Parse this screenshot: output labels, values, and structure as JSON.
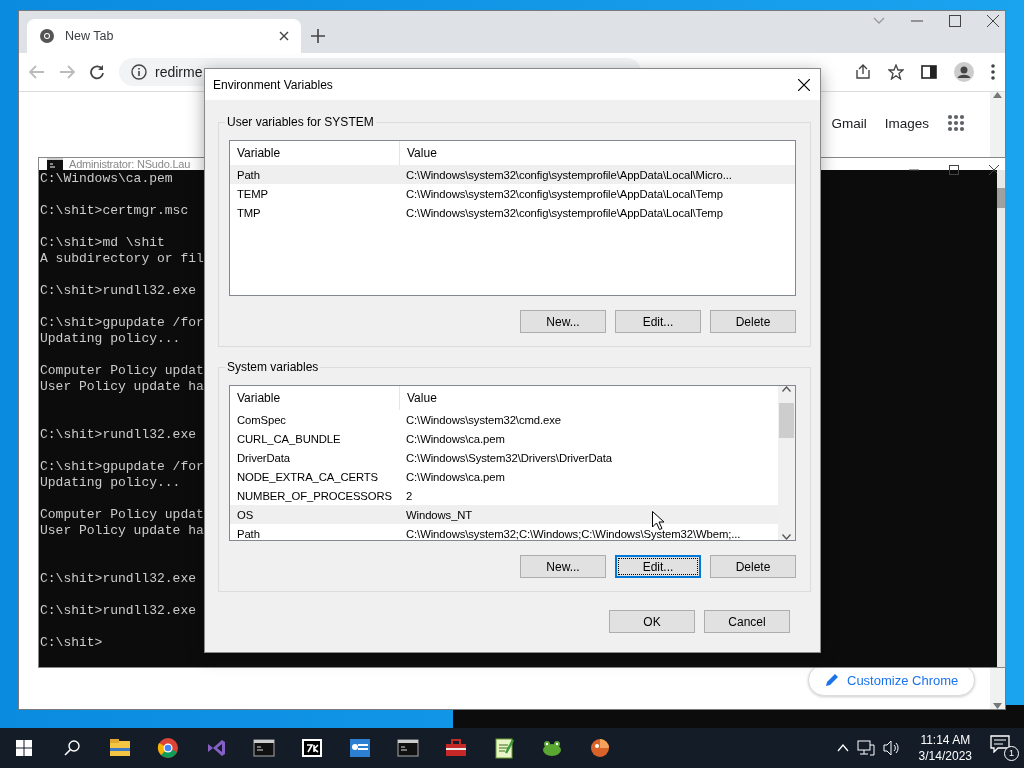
{
  "browser": {
    "tab": {
      "title": "New Tab"
    },
    "address": "redirme",
    "links": [
      "Gmail",
      "Images"
    ],
    "customize_button": "Customize Chrome"
  },
  "console": {
    "title": "Administrator: NSudo.Lau",
    "groups": [
      {
        "lines": [
          "C:\\Windows\\ca.pem"
        ],
        "extra_blank": false
      },
      {
        "lines": [
          "C:\\shit>certmgr.msc"
        ],
        "extra_blank": false
      },
      {
        "lines": [
          "C:\\shit>md \\shit",
          "A subdirectory or fil"
        ],
        "extra_blank": false
      },
      {
        "lines": [
          "C:\\shit>rundll32.exe"
        ],
        "extra_blank": false
      },
      {
        "lines": [
          "C:\\shit>gpupdate /for",
          "Updating policy..."
        ],
        "extra_blank": false
      },
      {
        "lines": [
          "Computer Policy updat",
          "User Policy update ha"
        ],
        "extra_blank": true
      },
      {
        "lines": [
          "C:\\shit>rundll32.exe"
        ],
        "extra_blank": false
      },
      {
        "lines": [
          "C:\\shit>gpupdate /for",
          "Updating policy..."
        ],
        "extra_blank": false
      },
      {
        "lines": [
          "Computer Policy updat",
          "User Policy update ha"
        ],
        "extra_blank": true
      },
      {
        "lines": [
          "C:\\shit>rundll32.exe"
        ],
        "extra_blank": false
      },
      {
        "lines": [
          "C:\\shit>rundll32.exe"
        ],
        "extra_blank": false
      },
      {
        "lines": [
          "C:\\shit>"
        ],
        "extra_blank": false
      }
    ]
  },
  "dialog": {
    "title": "Environment Variables",
    "sections": [
      {
        "label": "User variables for SYSTEM",
        "scrollable": false,
        "columns": [
          "Variable",
          "Value"
        ],
        "rows": [
          {
            "variable": "Path",
            "value": "C:\\Windows\\system32\\config\\systemprofile\\AppData\\Local\\Micro...",
            "selected": true
          },
          {
            "variable": "TEMP",
            "value": "C:\\Windows\\system32\\config\\systemprofile\\AppData\\Local\\Temp",
            "selected": false
          },
          {
            "variable": "TMP",
            "value": "C:\\Windows\\system32\\config\\systemprofile\\AppData\\Local\\Temp",
            "selected": false
          }
        ],
        "buttons": [
          {
            "label": "New...",
            "focused": false
          },
          {
            "label": "Edit...",
            "focused": false
          },
          {
            "label": "Delete",
            "focused": false
          }
        ]
      },
      {
        "label": "System variables",
        "scrollable": true,
        "columns": [
          "Variable",
          "Value"
        ],
        "rows": [
          {
            "variable": "ComSpec",
            "value": "C:\\Windows\\system32\\cmd.exe",
            "selected": false
          },
          {
            "variable": "CURL_CA_BUNDLE",
            "value": "C:\\Windows\\ca.pem",
            "selected": false
          },
          {
            "variable": "DriverData",
            "value": "C:\\Windows\\System32\\Drivers\\DriverData",
            "selected": false
          },
          {
            "variable": "NODE_EXTRA_CA_CERTS",
            "value": "C:\\Windows\\ca.pem",
            "selected": false
          },
          {
            "variable": "NUMBER_OF_PROCESSORS",
            "value": "2",
            "selected": false
          },
          {
            "variable": "OS",
            "value": "Windows_NT",
            "selected": true
          },
          {
            "variable": "Path",
            "value": "C:\\Windows\\system32;C:\\Windows;C:\\Windows\\System32\\Wbem;...",
            "selected": false
          }
        ],
        "buttons": [
          {
            "label": "New...",
            "focused": false
          },
          {
            "label": "Edit...",
            "focused": true
          },
          {
            "label": "Delete",
            "focused": false
          }
        ]
      }
    ],
    "buttons": [
      {
        "label": "OK",
        "focused": false
      },
      {
        "label": "Cancel",
        "focused": false
      }
    ]
  },
  "taskbar": {
    "time": "11:14 AM",
    "date": "3/14/2023",
    "notification_count": "1"
  }
}
